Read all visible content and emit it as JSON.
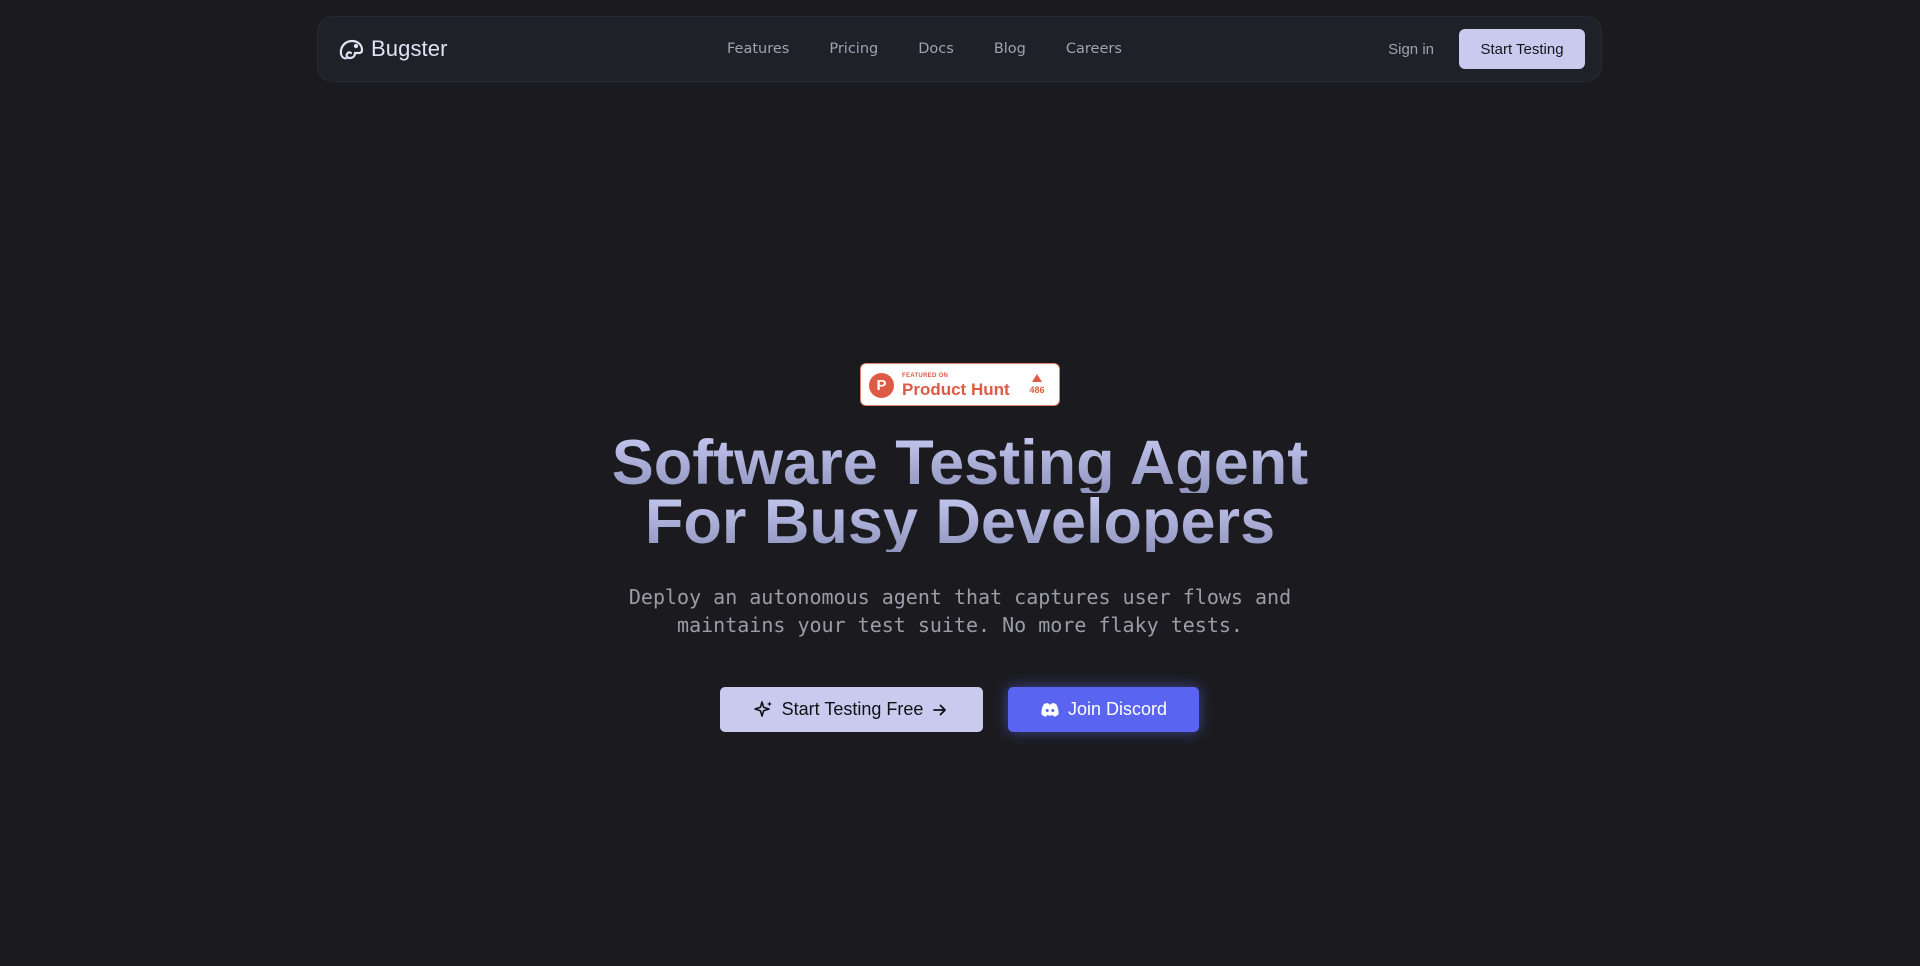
{
  "nav": {
    "brand": "Bugster",
    "links": [
      "Features",
      "Pricing",
      "Docs",
      "Blog",
      "Careers"
    ],
    "sign_in": "Sign in",
    "cta": "Start Testing"
  },
  "badge": {
    "featured_on": "FEATURED ON",
    "name": "Product Hunt",
    "logo_letter": "P",
    "votes": "486"
  },
  "hero": {
    "title_line1": "Software Testing Agent",
    "title_line2": "For Busy Developers",
    "subtitle_line1": "Deploy an autonomous agent that captures user flows and",
    "subtitle_line2": "maintains your test suite. No more flaky tests.",
    "primary_cta": "Start Testing Free",
    "secondary_cta": "Join Discord"
  },
  "colors": {
    "background": "#1b1b1f",
    "nav_background": "#1f2129",
    "accent_light": "#c9cbee",
    "discord": "#5964f0",
    "product_hunt": "#dd5b45"
  },
  "icons": {
    "brand": "chameleon-logo-icon",
    "primary_cta_leading": "sparkles-icon",
    "primary_cta_trailing": "arrow-right-icon",
    "secondary_cta_leading": "discord-icon",
    "badge_vote": "upvote-triangle-icon"
  }
}
